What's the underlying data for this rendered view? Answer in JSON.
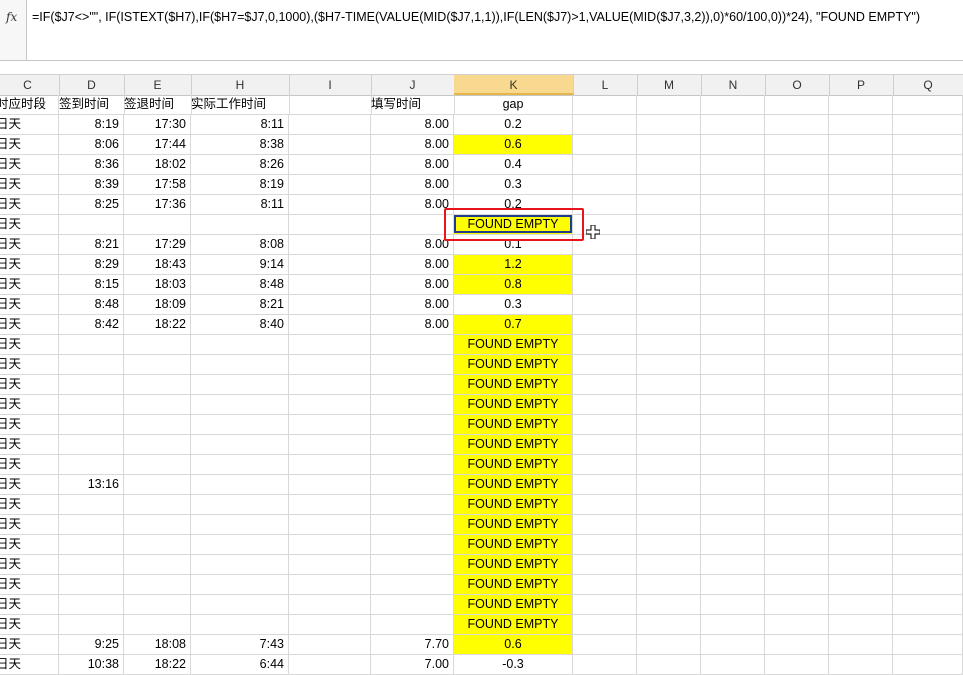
{
  "formula_bar": {
    "fx_label": "fx",
    "formula": "=IF($J7<>\"\", IF(ISTEXT($H7),IF($H7=$J7,0,1000),($H7-TIME(VALUE(MID($J7,1,1)),IF(LEN($J7)>1,VALUE(MID($J7,3,2)),0)*60/100,0))*24), \"FOUND EMPTY\")"
  },
  "columns": [
    "C",
    "D",
    "E",
    "H",
    "I",
    "J",
    "K",
    "L",
    "M",
    "N",
    "O",
    "P",
    "Q"
  ],
  "active_column": "K",
  "headers": {
    "C": "时应时段",
    "D": "签到时间",
    "E": "签退时间",
    "H": "实际工作时间",
    "I": "",
    "J": "填写时间",
    "K": "gap"
  },
  "rows": [
    {
      "C": "日天",
      "D": "8:19",
      "E": "17:30",
      "H": "8:11",
      "J": "8.00",
      "K": "0.2",
      "hl": false
    },
    {
      "C": "日天",
      "D": "8:06",
      "E": "17:44",
      "H": "8:38",
      "J": "8.00",
      "K": "0.6",
      "hl": true
    },
    {
      "C": "日天",
      "D": "8:36",
      "E": "18:02",
      "H": "8:26",
      "J": "8.00",
      "K": "0.4",
      "hl": false
    },
    {
      "C": "日天",
      "D": "8:39",
      "E": "17:58",
      "H": "8:19",
      "J": "8.00",
      "K": "0.3",
      "hl": false
    },
    {
      "C": "日天",
      "D": "8:25",
      "E": "17:36",
      "H": "8:11",
      "J": "8.00",
      "K": "0.2",
      "hl": false
    },
    {
      "C": "日天",
      "D": "",
      "E": "",
      "H": "",
      "J": "",
      "K": "FOUND EMPTY",
      "hl": true
    },
    {
      "C": "日天",
      "D": "8:21",
      "E": "17:29",
      "H": "8:08",
      "J": "8.00",
      "K": "0.1",
      "hl": false
    },
    {
      "C": "日天",
      "D": "8:29",
      "E": "18:43",
      "H": "9:14",
      "J": "8.00",
      "K": "1.2",
      "hl": true
    },
    {
      "C": "日天",
      "D": "8:15",
      "E": "18:03",
      "H": "8:48",
      "J": "8.00",
      "K": "0.8",
      "hl": true
    },
    {
      "C": "日天",
      "D": "8:48",
      "E": "18:09",
      "H": "8:21",
      "J": "8.00",
      "K": "0.3",
      "hl": false
    },
    {
      "C": "日天",
      "D": "8:42",
      "E": "18:22",
      "H": "8:40",
      "J": "8.00",
      "K": "0.7",
      "hl": true
    },
    {
      "C": "日天",
      "D": "",
      "E": "",
      "H": "",
      "J": "",
      "K": "FOUND EMPTY",
      "hl": true
    },
    {
      "C": "日天",
      "D": "",
      "E": "",
      "H": "",
      "J": "",
      "K": "FOUND EMPTY",
      "hl": true
    },
    {
      "C": "日天",
      "D": "",
      "E": "",
      "H": "",
      "J": "",
      "K": "FOUND EMPTY",
      "hl": true
    },
    {
      "C": "日天",
      "D": "",
      "E": "",
      "H": "",
      "J": "",
      "K": "FOUND EMPTY",
      "hl": true
    },
    {
      "C": "日天",
      "D": "",
      "E": "",
      "H": "",
      "J": "",
      "K": "FOUND EMPTY",
      "hl": true
    },
    {
      "C": "日天",
      "D": "",
      "E": "",
      "H": "",
      "J": "",
      "K": "FOUND EMPTY",
      "hl": true
    },
    {
      "C": "日天",
      "D": "",
      "E": "",
      "H": "",
      "J": "",
      "K": "FOUND EMPTY",
      "hl": true
    },
    {
      "C": "日天",
      "D": "13:16",
      "E": "",
      "H": "",
      "J": "",
      "K": "FOUND EMPTY",
      "hl": true
    },
    {
      "C": "日天",
      "D": "",
      "E": "",
      "H": "",
      "J": "",
      "K": "FOUND EMPTY",
      "hl": true
    },
    {
      "C": "日天",
      "D": "",
      "E": "",
      "H": "",
      "J": "",
      "K": "FOUND EMPTY",
      "hl": true
    },
    {
      "C": "日天",
      "D": "",
      "E": "",
      "H": "",
      "J": "",
      "K": "FOUND EMPTY",
      "hl": true
    },
    {
      "C": "日天",
      "D": "",
      "E": "",
      "H": "",
      "J": "",
      "K": "FOUND EMPTY",
      "hl": true
    },
    {
      "C": "日天",
      "D": "",
      "E": "",
      "H": "",
      "J": "",
      "K": "FOUND EMPTY",
      "hl": true
    },
    {
      "C": "日天",
      "D": "",
      "E": "",
      "H": "",
      "J": "",
      "K": "FOUND EMPTY",
      "hl": true
    },
    {
      "C": "日天",
      "D": "",
      "E": "",
      "H": "",
      "J": "",
      "K": "FOUND EMPTY",
      "hl": true
    },
    {
      "C": "日天",
      "D": "9:25",
      "E": "18:08",
      "H": "7:43",
      "J": "7.70",
      "K": "0.6",
      "hl": true
    },
    {
      "C": "日天",
      "D": "10:38",
      "E": "18:22",
      "H": "6:44",
      "J": "7.00",
      "K": "-0.3",
      "hl": false
    }
  ],
  "colors": {
    "highlight": "#ffff00",
    "selection_border": "#1f3d8a",
    "annotation_box": "#e8141b"
  }
}
